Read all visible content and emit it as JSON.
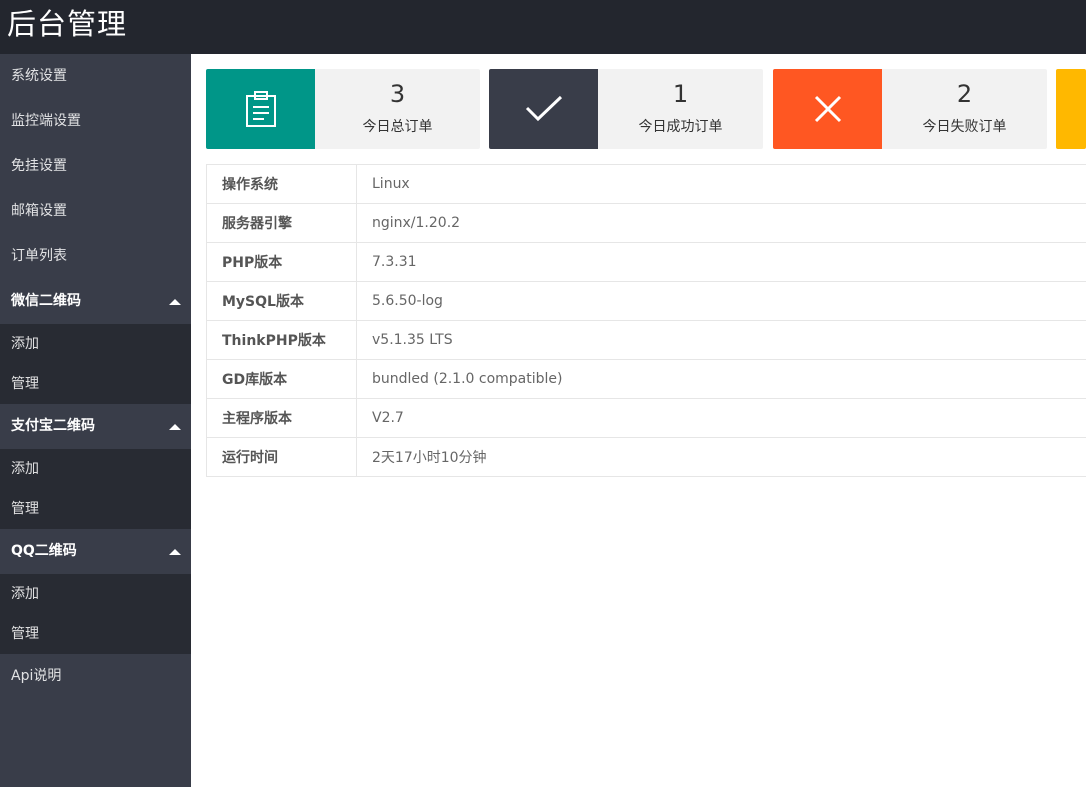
{
  "header": {
    "title": "后台管理"
  },
  "sidebar": {
    "items": [
      {
        "label": "系统设置"
      },
      {
        "label": "监控端设置"
      },
      {
        "label": "免挂设置"
      },
      {
        "label": "邮箱设置"
      },
      {
        "label": "订单列表"
      }
    ],
    "groups": [
      {
        "label": "微信二维码",
        "children": [
          {
            "label": "添加"
          },
          {
            "label": "管理"
          }
        ]
      },
      {
        "label": "支付宝二维码",
        "children": [
          {
            "label": "添加"
          },
          {
            "label": "管理"
          }
        ]
      },
      {
        "label": "QQ二维码",
        "children": [
          {
            "label": "添加"
          },
          {
            "label": "管理"
          }
        ]
      }
    ],
    "api": {
      "label": "Api说明"
    }
  },
  "cards": [
    {
      "value": "3",
      "label": "今日总订单",
      "color": "#009688",
      "icon": "clipboard-icon"
    },
    {
      "value": "1",
      "label": "今日成功订单",
      "color": "#393d49",
      "icon": "check-icon"
    },
    {
      "value": "2",
      "label": "今日失败订单",
      "color": "#ff5722",
      "icon": "close-icon"
    },
    {
      "value": "",
      "label": "",
      "color": "#ffb800",
      "icon": ""
    }
  ],
  "info": {
    "rows": [
      {
        "key": "操作系统",
        "value": "Linux"
      },
      {
        "key": "服务器引擎",
        "value": "nginx/1.20.2"
      },
      {
        "key": "PHP版本",
        "value": "7.3.31"
      },
      {
        "key": "MySQL版本",
        "value": "5.6.50-log"
      },
      {
        "key": "ThinkPHP版本",
        "value": "v5.1.35 LTS"
      },
      {
        "key": "GD库版本",
        "value": "bundled (2.1.0 compatible)"
      },
      {
        "key": "主程序版本",
        "value": "V2.7"
      },
      {
        "key": "运行时间",
        "value": "2天17小时10分钟"
      }
    ]
  }
}
